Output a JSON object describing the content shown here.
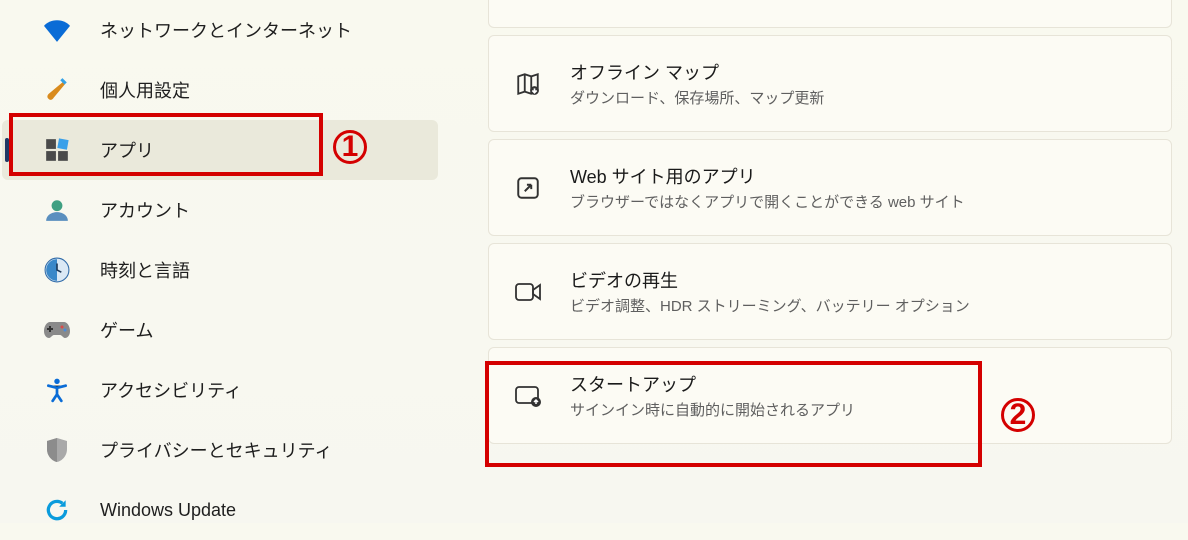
{
  "sidebar": {
    "items": [
      {
        "label": "ネットワークとインターネット",
        "icon": "wifi-icon"
      },
      {
        "label": "個人用設定",
        "icon": "paint-icon"
      },
      {
        "label": "アプリ",
        "icon": "apps-icon",
        "active": true
      },
      {
        "label": "アカウント",
        "icon": "account-icon"
      },
      {
        "label": "時刻と言語",
        "icon": "time-icon"
      },
      {
        "label": "ゲーム",
        "icon": "gamepad-icon"
      },
      {
        "label": "アクセシビリティ",
        "icon": "accessibility-icon"
      },
      {
        "label": "プライバシーとセキュリティ",
        "icon": "shield-icon"
      },
      {
        "label": "Windows Update",
        "icon": "update-icon"
      }
    ]
  },
  "main": {
    "cards": [
      {
        "title": "オフライン マップ",
        "subtitle": "ダウンロード、保存場所、マップ更新",
        "icon": "map-icon"
      },
      {
        "title": "Web サイト用のアプリ",
        "subtitle": "ブラウザーではなくアプリで開くことができる web サイト",
        "icon": "open-icon"
      },
      {
        "title": "ビデオの再生",
        "subtitle": "ビデオ調整、HDR ストリーミング、バッテリー オプション",
        "icon": "video-icon"
      },
      {
        "title": "スタートアップ",
        "subtitle": "サインイン時に自動的に開始されるアプリ",
        "icon": "startup-icon"
      }
    ]
  },
  "annotations": {
    "one": "1",
    "two": "2"
  }
}
